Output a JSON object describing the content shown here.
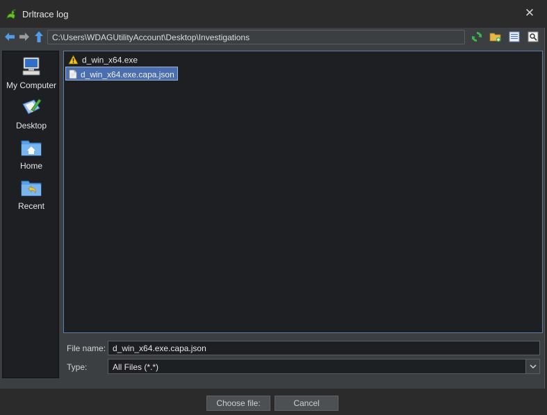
{
  "window": {
    "title": "Drltrace log",
    "close_glyph": "✕"
  },
  "toolbar": {
    "path": "C:\\Users\\WDAGUtilityAccount\\Desktop\\Investigations",
    "icons": [
      "back-arrow-icon",
      "forward-arrow-icon",
      "up-arrow-icon",
      "refresh-icon",
      "new-folder-icon",
      "list-view-icon",
      "details-view-icon"
    ]
  },
  "places": [
    {
      "label": "My Computer",
      "icon": "computer-icon"
    },
    {
      "label": "Desktop",
      "icon": "desktop-icon"
    },
    {
      "label": "Home",
      "icon": "home-folder-icon"
    },
    {
      "label": "Recent",
      "icon": "recent-folder-icon"
    }
  ],
  "files": [
    {
      "name": "d_win_x64.exe",
      "icon": "warning-icon",
      "selected": false
    },
    {
      "name": "d_win_x64.exe.capa.json",
      "icon": "file-icon",
      "selected": true
    }
  ],
  "form": {
    "filename_label": "File name:",
    "filename_value": "d_win_x64.exe.capa.json",
    "type_label": "Type:",
    "type_value": "All Files (*.*)"
  },
  "buttons": {
    "choose": "Choose file:",
    "cancel": "Cancel"
  },
  "colors": {
    "accent": "#4b6eaf",
    "panel": "#1e1f22",
    "chrome": "#3c3f41"
  }
}
